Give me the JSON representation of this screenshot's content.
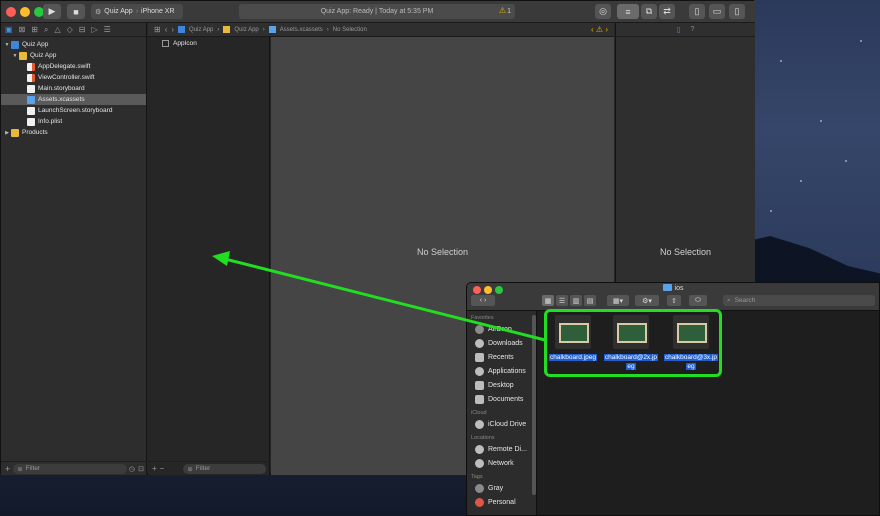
{
  "xcode": {
    "scheme_target": "Quiz App",
    "scheme_device": "iPhone XR",
    "status_text": "Quiz App: Ready | Today at 5:35 PM",
    "warning_count": "1",
    "navigator_items": [
      {
        "label": "Quiz App",
        "kind": "proj",
        "indent": 0,
        "disclosure": "▼"
      },
      {
        "label": "Quiz App",
        "kind": "folder",
        "indent": 1,
        "disclosure": "▼"
      },
      {
        "label": "AppDelegate.swift",
        "kind": "swift",
        "indent": 2,
        "disclosure": ""
      },
      {
        "label": "ViewController.swift",
        "kind": "swift",
        "indent": 2,
        "disclosure": ""
      },
      {
        "label": "Main.storyboard",
        "kind": "doc",
        "indent": 2,
        "disclosure": ""
      },
      {
        "label": "Assets.xcassets",
        "kind": "assets",
        "indent": 2,
        "disclosure": "",
        "selected": true
      },
      {
        "label": "LaunchScreen.storyboard",
        "kind": "doc",
        "indent": 2,
        "disclosure": ""
      },
      {
        "label": "Info.plist",
        "kind": "doc",
        "indent": 2,
        "disclosure": ""
      },
      {
        "label": "Products",
        "kind": "folder",
        "indent": 0,
        "disclosure": "▶"
      }
    ],
    "filter_placeholder": "Filter",
    "breadcrumbs": [
      "Quiz App",
      "Quiz App",
      "Assets.xcassets",
      "No Selection"
    ],
    "asset_items": [
      "AppIcon"
    ],
    "editor_empty": "No Selection",
    "inspector_empty": "No Selection"
  },
  "finder": {
    "title": "ios",
    "search_placeholder": "Search",
    "sections": [
      {
        "heading": "Favorites",
        "items": [
          {
            "label": "AirDrop",
            "icon": "airdrop-icon"
          },
          {
            "label": "Downloads",
            "icon": "downloads-icon"
          },
          {
            "label": "Recents",
            "icon": "recents-icon"
          },
          {
            "label": "Applications",
            "icon": "applications-icon"
          },
          {
            "label": "Desktop",
            "icon": "desktop-icon"
          },
          {
            "label": "Documents",
            "icon": "documents-icon"
          }
        ]
      },
      {
        "heading": "iCloud",
        "items": [
          {
            "label": "iCloud Drive",
            "icon": "icloud-icon"
          }
        ]
      },
      {
        "heading": "Locations",
        "items": [
          {
            "label": "Remote Di...",
            "icon": "remote-disc-icon"
          },
          {
            "label": "Network",
            "icon": "network-icon"
          }
        ]
      },
      {
        "heading": "Tags",
        "items": [
          {
            "label": "Gray",
            "icon": "gray-tag-icon"
          },
          {
            "label": "Personal",
            "icon": "red-tag-icon"
          }
        ]
      }
    ],
    "files": [
      {
        "line1": "chalkboard.jpeg",
        "line2": ""
      },
      {
        "line1": "chalkboard@2x.jp",
        "line2": "eg"
      },
      {
        "line1": "chalkboard@3x.jp",
        "line2": "eg"
      }
    ]
  },
  "colors": {
    "highlight_green": "#22dd22",
    "selection_blue": "#1f5fcf",
    "accent_blue": "#4a90e2",
    "warning_yellow": "#e6b400"
  }
}
